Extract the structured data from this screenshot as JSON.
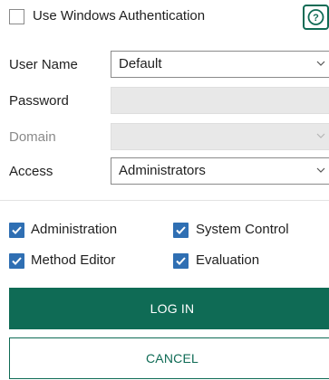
{
  "auth": {
    "use_windows_auth_label": "Use Windows Authentication",
    "use_windows_auth_checked": false
  },
  "form": {
    "user_name": {
      "label": "User Name",
      "value": "Default"
    },
    "password": {
      "label": "Password",
      "value": ""
    },
    "domain": {
      "label": "Domain",
      "value": ""
    },
    "access": {
      "label": "Access",
      "value": "Administrators"
    }
  },
  "permissions": [
    {
      "label": "Administration",
      "checked": true
    },
    {
      "label": "System Control",
      "checked": true
    },
    {
      "label": "Method Editor",
      "checked": true
    },
    {
      "label": "Evaluation",
      "checked": true
    }
  ],
  "buttons": {
    "login_label": "LOG IN",
    "cancel_label": "CANCEL"
  },
  "colors": {
    "primary": "#0f6b55",
    "checkbox": "#2f6fb3",
    "help": "#0f6b55"
  },
  "icons": {
    "help": "help-icon",
    "dropdown": "chevron-down-icon"
  }
}
